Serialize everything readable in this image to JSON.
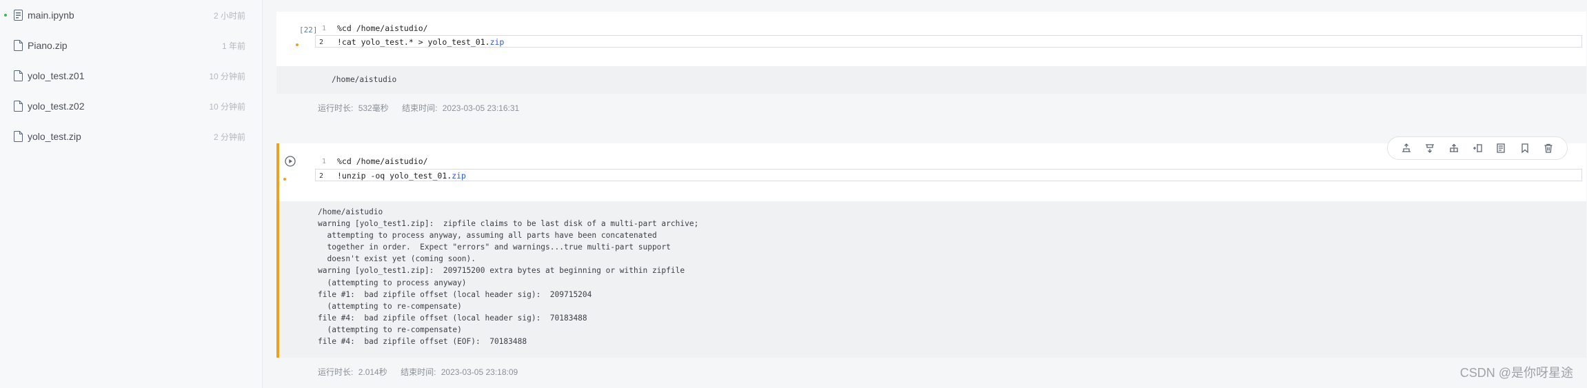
{
  "sidebar": {
    "files": [
      {
        "name": "main.ipynb",
        "time": "2 小时前",
        "icon": "notebook-icon",
        "active": true
      },
      {
        "name": "Piano.zip",
        "time": "1 年前",
        "icon": "file-icon",
        "active": false
      },
      {
        "name": "yolo_test.z01",
        "time": "10 分钟前",
        "icon": "file-icon",
        "active": false
      },
      {
        "name": "yolo_test.z02",
        "time": "10 分钟前",
        "icon": "file-icon",
        "active": false
      },
      {
        "name": "yolo_test.zip",
        "time": "2 分钟前",
        "icon": "file-icon",
        "active": false
      }
    ]
  },
  "cells": [
    {
      "exec_count": "[22]",
      "lines": [
        {
          "no": "1",
          "text": "%cd /home/aistudio/"
        },
        {
          "no": "2",
          "text": "!cat yolo_test.* > yolo_test_01.",
          "ext": "zip"
        }
      ],
      "output": "/home/aistudio",
      "meta": {
        "duration_label": "运行时长:",
        "duration": "532毫秒",
        "end_label": "结束时间:",
        "end_time": "2023-03-05 23:16:31"
      }
    },
    {
      "lines": [
        {
          "no": "1",
          "text": "%cd /home/aistudio/"
        },
        {
          "no": "2",
          "text": "!unzip -oq yolo_test_01.",
          "ext": "zip"
        }
      ],
      "output": "/home/aistudio\nwarning [yolo_test1.zip]:  zipfile claims to be last disk of a multi-part archive;\n  attempting to process anyway, assuming all parts have been concatenated\n  together in order.  Expect \"errors\" and warnings...true multi-part support\n  doesn't exist yet (coming soon).\nwarning [yolo_test1.zip]:  209715200 extra bytes at beginning or within zipfile\n  (attempting to process anyway)\nfile #1:  bad zipfile offset (local header sig):  209715204\n  (attempting to re-compensate)\nfile #4:  bad zipfile offset (local header sig):  70183488\n  (attempting to re-compensate)\nfile #4:  bad zipfile offset (EOF):  70183488",
      "meta": {
        "duration_label": "运行时长:",
        "duration": "2.014秒",
        "end_label": "结束时间:",
        "end_time": "2023-03-05 23:18:09"
      }
    }
  ],
  "toolbar": {
    "buttons": [
      "run-above-icon",
      "run-below-icon",
      "split-cell-icon",
      "insert-cell-icon",
      "copy-cell-icon",
      "bookmark-icon",
      "delete-icon"
    ]
  },
  "watermark": "CSDN @是你呀星途",
  "colors": {
    "accent_bar": "#f0a020",
    "zip_keyword": "#2f57d6",
    "active_dot": "#3cba54"
  }
}
